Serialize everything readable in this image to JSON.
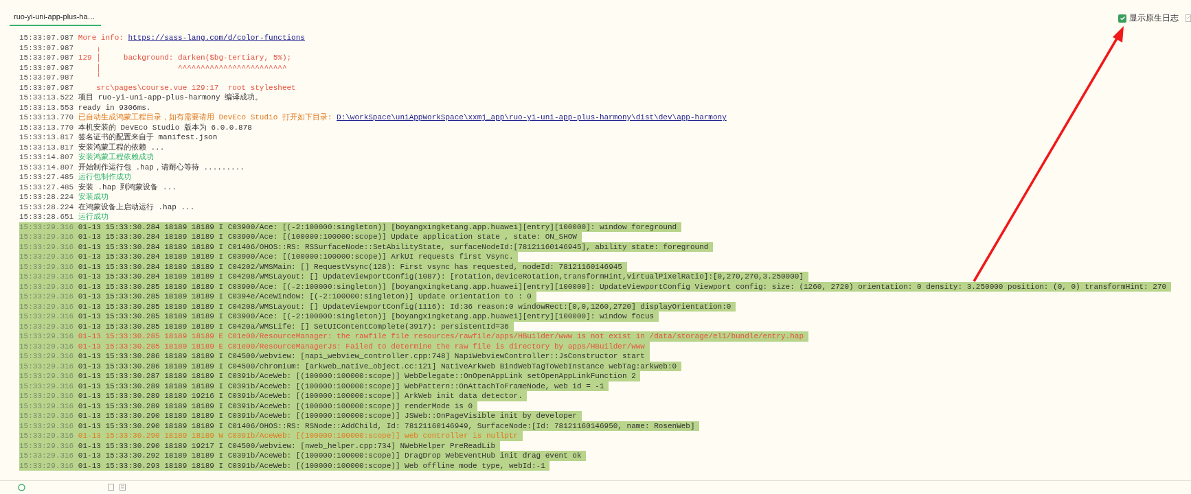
{
  "tabs": [
    {
      "label": "ruo-yi-uni-app-plus-ha…",
      "selected": true
    }
  ],
  "native_log_toggle": {
    "label": "显示原生日志",
    "checked": true
  },
  "log_lines": [
    {
      "time": "15:33:07.987",
      "kind": "error",
      "text": "More info: ",
      "link": "https://sass-lang.com/d/color-functions",
      "selected": false
    },
    {
      "time": "15:33:07.987",
      "kind": "error",
      "text": "    ╷",
      "selected": false
    },
    {
      "time": "15:33:07.987",
      "kind": "error",
      "text": "129 │     background: darken($bg-tertiary, 5%);",
      "selected": false
    },
    {
      "time": "15:33:07.987",
      "kind": "error",
      "text": "    │                 ^^^^^^^^^^^^^^^^^^^^^^^^",
      "selected": false
    },
    {
      "time": "15:33:07.987",
      "kind": "error",
      "text": "    ╵",
      "selected": false
    },
    {
      "time": "15:33:07.987",
      "kind": "error",
      "text": "    src\\pages\\course.vue 129:17  root stylesheet",
      "selected": false
    },
    {
      "time": "15:33:13.522",
      "kind": "normal",
      "text": "项目 ruo-yi-uni-app-plus-harmony 编译成功。",
      "selected": false
    },
    {
      "time": "15:33:13.553",
      "kind": "normal",
      "text": "ready in 9306ms.",
      "selected": false
    },
    {
      "time": "15:33:13.770",
      "kind": "warn",
      "text": "已自动生成鸿蒙工程目录，如有需要请用 DevEco Studio 打开如下目录: ",
      "link": "D:\\workSpace\\uniAppWorkSpace\\xxmj_app\\ruo-yi-uni-app-plus-harmony\\dist\\dev\\app-harmony",
      "selected": false
    },
    {
      "time": "15:33:13.770",
      "kind": "normal",
      "text": "本机安装的 DevEco Studio 版本为 6.0.0.878",
      "selected": false
    },
    {
      "time": "15:33:13.817",
      "kind": "normal",
      "text": "签名证书的配置来自于 manifest.json",
      "selected": false
    },
    {
      "time": "15:33:13.817",
      "kind": "normal",
      "text": "安装鸿蒙工程的依赖 ...",
      "selected": false
    },
    {
      "time": "15:33:14.807",
      "kind": "success",
      "text": "安装鸿蒙工程依赖成功",
      "selected": false
    },
    {
      "time": "15:33:14.807",
      "kind": "normal",
      "text": "开始制作运行包 .hap，请耐心等待 .........",
      "selected": false
    },
    {
      "time": "15:33:27.485",
      "kind": "success",
      "text": "运行包制作成功",
      "selected": false
    },
    {
      "time": "15:33:27.485",
      "kind": "normal",
      "text": "安装 .hap 到鸿蒙设备 ...",
      "selected": false
    },
    {
      "time": "15:33:28.224",
      "kind": "success",
      "text": "安装成功",
      "selected": false
    },
    {
      "time": "15:33:28.224",
      "kind": "normal",
      "text": "在鸿蒙设备上启动运行 .hap ...",
      "selected": false
    },
    {
      "time": "15:33:28.651",
      "kind": "success",
      "text": "运行成功",
      "selected": false
    },
    {
      "time": "15:33:29.316",
      "kind": "normal",
      "text": "01-13 15:33:30.284 18189 18189 I C03900/Ace: [(-2:100000:singleton)] [boyangxingketang.app.huawei][entry][100000]: window foreground ",
      "selected": true
    },
    {
      "time": "15:33:29.316",
      "kind": "normal",
      "text": "01-13 15:33:30.284 18189 18189 I C03900/Ace: [(100000:100000:scope)] Update application state , state: ON_SHOW ",
      "selected": true
    },
    {
      "time": "15:33:29.316",
      "kind": "normal",
      "text": "01-13 15:33:30.284 18189 18189 I C01406/OHOS::RS: RSSurfaceNode::SetAbilityState, surfaceNodeId:[78121160146945], ability state: foreground ",
      "selected": true
    },
    {
      "time": "15:33:29.316",
      "kind": "normal",
      "text": "01-13 15:33:30.284 18189 18189 I C03900/Ace: [(100000:100000:scope)] ArkUI requests first Vsync. ",
      "selected": true
    },
    {
      "time": "15:33:29.316",
      "kind": "normal",
      "text": "01-13 15:33:30.284 18189 18189 I C04202/WMSMain: [] RequestVsync(128): First vsync has requested, nodeId: 78121160146945 ",
      "selected": true
    },
    {
      "time": "15:33:29.316",
      "kind": "normal",
      "text": "01-13 15:33:30.284 18189 18189 I C04208/WMSLayout: [] UpdateViewportConfig(1087): [rotation,deviceRotation,transformHint,virtualPixelRatio]:[0,270,270,3.250000] ",
      "selected": true
    },
    {
      "time": "15:33:29.316",
      "kind": "normal",
      "text": "01-13 15:33:30.285 18189 18189 I C03900/Ace: [(-2:100000:singleton)] [boyangxingketang.app.huawei][entry][100000]: UpdateViewportConfig Viewport config: size: (1260, 2720) orientation: 0 density: 3.250000 position: (0, 0) transformHint: 270 ",
      "selected": true
    },
    {
      "time": "15:33:29.316",
      "kind": "normal",
      "text": "01-13 15:33:30.285 18189 18189 I C0394e/AceWindow: [(-2:100000:singleton)] Update orientation to : 0 ",
      "selected": true
    },
    {
      "time": "15:33:29.316",
      "kind": "normal",
      "text": "01-13 15:33:30.285 18189 18189 I C04208/WMSLayout: [] UpdateViewportConfig(1116): Id:36 reason:0 windowRect:[0,0,1260,2720] displayOrientation:0 ",
      "selected": true
    },
    {
      "time": "15:33:29.316",
      "kind": "normal",
      "text": "01-13 15:33:30.285 18189 18189 I C03900/Ace: [(-2:100000:singleton)] [boyangxingketang.app.huawei][entry][100000]: window focus ",
      "selected": true
    },
    {
      "time": "15:33:29.316",
      "kind": "normal",
      "text": "01-13 15:33:30.285 18189 18189 I C0420a/WMSLife: [] SetUIContentComplete(3917): persistentId=36 ",
      "selected": true
    },
    {
      "time": "15:33:29.316",
      "kind": "error",
      "text": "01-13 15:33:30.285 18189 18189 E C01e00/ResourceManager: the rawfile file resources/rawfile/apps/HBuilder/www is not exist in /data/storage/el1/bundle/entry.hap ",
      "selected": true
    },
    {
      "time": "15:33:29.316",
      "kind": "error",
      "text": "01-13 15:33:30.285 18189 18189 E C01e00/ResourceManagerJs: Failed to determine the raw file is directory by apps/HBuilder/www ",
      "selected": true
    },
    {
      "time": "15:33:29.316",
      "kind": "normal",
      "text": "01-13 15:33:30.286 18189 18189 I C04500/webview: [napi_webview_controller.cpp:748] NapiWebviewController::JsConstructor start ",
      "selected": true
    },
    {
      "time": "15:33:29.316",
      "kind": "normal",
      "text": "01-13 15:33:30.286 18189 18189 I C04500/chromium: [arkweb_native_object.cc:121] NativeArkWeb BindWebTagToWebInstance webTag:arkweb:0 ",
      "selected": true
    },
    {
      "time": "15:33:29.316",
      "kind": "normal",
      "text": "01-13 15:33:30.287 18189 18189 I C0391b/AceWeb: [(100000:100000:scope)] WebDelegate::OnOpenAppLink setOpenAppLinkFunction 2 ",
      "selected": true
    },
    {
      "time": "15:33:29.316",
      "kind": "normal",
      "text": "01-13 15:33:30.289 18189 18189 I C0391b/AceWeb: [(100000:100000:scope)] WebPattern::OnAttachToFrameNode, web id = -1 ",
      "selected": true
    },
    {
      "time": "15:33:29.316",
      "kind": "normal",
      "text": "01-13 15:33:30.289 18189 19216 I C0391b/AceWeb: [(100000:100000:scope)] ArkWeb init data detector. ",
      "selected": true
    },
    {
      "time": "15:33:29.316",
      "kind": "normal",
      "text": "01-13 15:33:30.289 18189 18189 I C0391b/AceWeb: [(100000:100000:scope)] renderMode is 0 ",
      "selected": true
    },
    {
      "time": "15:33:29.316",
      "kind": "normal",
      "text": "01-13 15:33:30.290 18189 18189 I C0391b/AceWeb: [(100000:100000:scope)] JSWeb::OnPageVisible init by developer ",
      "selected": true
    },
    {
      "time": "15:33:29.316",
      "kind": "normal",
      "text": "01-13 15:33:30.290 18189 18189 I C01406/OHOS::RS: RSNode::AddChild, Id: 78121160146949, SurfaceNode:[Id: 78121160146950, name: RosenWeb] ",
      "selected": true
    },
    {
      "time": "15:33:29.316",
      "kind": "warn",
      "text": "01-13 15:33:30.290 18189 18189 W C0391b/AceWeb: [(100000:100000:scope)] web controller is nullptr ",
      "selected": true
    },
    {
      "time": "15:33:29.316",
      "kind": "normal",
      "text": "01-13 15:33:30.290 18189 19217 I C04500/webview: [nweb_helper.cpp:734] NWebHelper PreReadLib ",
      "selected": true
    },
    {
      "time": "15:33:29.316",
      "kind": "normal",
      "text": "01-13 15:33:30.292 18189 18189 I C0391b/AceWeb: [(100000:100000:scope)] DragDrop WebEventHub init drag event ok ",
      "selected": true
    },
    {
      "time": "15:33:29.316",
      "kind": "normal",
      "text": "01-13 15:33:30.293 18189 18189 I C0391b/AceWeb: [(100000:100000:scope)] Web offline mode type, webId:-1 ",
      "selected": true
    }
  ]
}
